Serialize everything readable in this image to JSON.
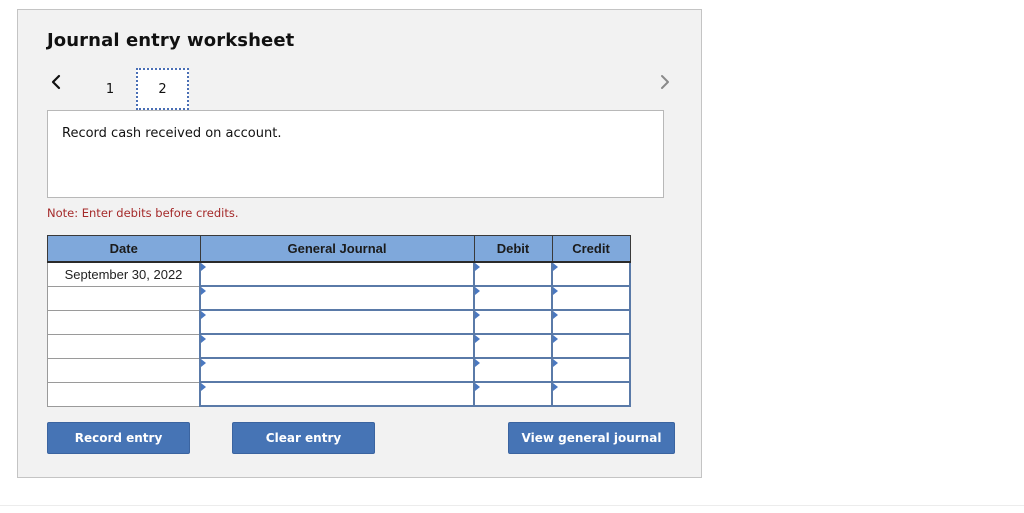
{
  "worksheet": {
    "title": "Journal entry worksheet",
    "nav": {
      "prev_icon": "chevron-left-icon",
      "next_icon": "chevron-right-icon",
      "pages": [
        {
          "label": "1",
          "active": false
        },
        {
          "label": "2",
          "active": true
        }
      ]
    },
    "prompt": "Record cash received on account.",
    "note": "Note: Enter debits before credits.",
    "table": {
      "headers": {
        "date": "Date",
        "general_journal": "General Journal",
        "debit": "Debit",
        "credit": "Credit"
      },
      "rows": [
        {
          "date": "September 30, 2022",
          "account": "",
          "debit": "",
          "credit": ""
        },
        {
          "date": "",
          "account": "",
          "debit": "",
          "credit": ""
        },
        {
          "date": "",
          "account": "",
          "debit": "",
          "credit": ""
        },
        {
          "date": "",
          "account": "",
          "debit": "",
          "credit": ""
        },
        {
          "date": "",
          "account": "",
          "debit": "",
          "credit": ""
        },
        {
          "date": "",
          "account": "",
          "debit": "",
          "credit": ""
        }
      ]
    },
    "buttons": {
      "record": "Record entry",
      "clear": "Clear entry",
      "view": "View general journal"
    }
  },
  "colors": {
    "header_bg": "#7fa8db",
    "button_bg": "#4674b5",
    "note_text": "#a52a2a",
    "panel_bg": "#f2f2f2"
  }
}
